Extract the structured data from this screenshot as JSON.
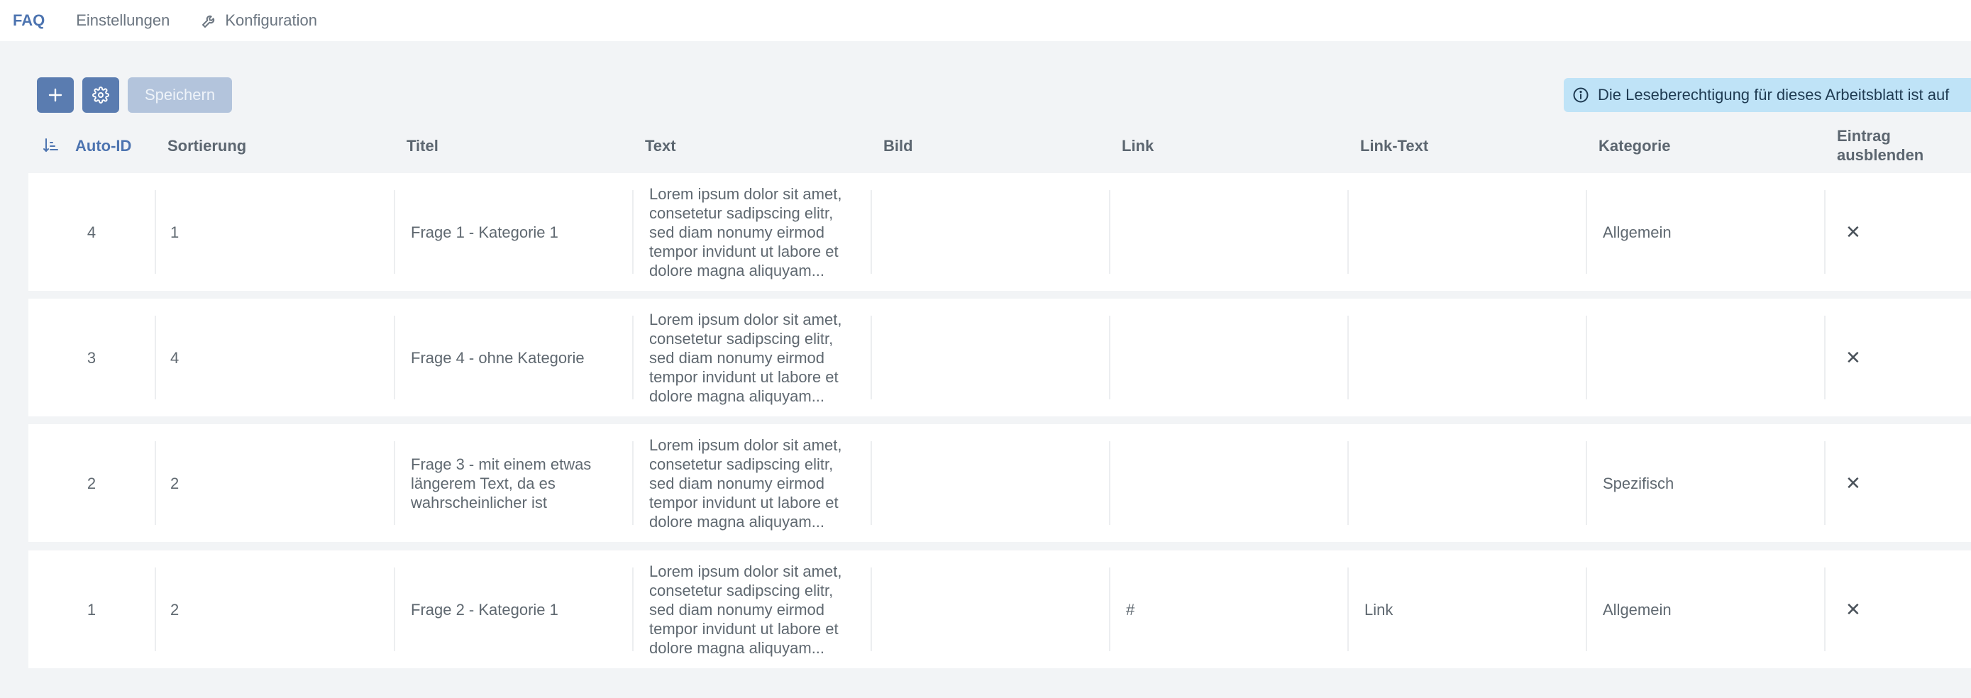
{
  "nav": {
    "tabs": [
      {
        "label": "FAQ"
      },
      {
        "label": "Einstellungen"
      },
      {
        "label": "Konfiguration"
      }
    ]
  },
  "toolbar": {
    "save_label": "Speichern"
  },
  "info_banner": {
    "text": "Die Leseberechtigung für dieses Arbeitsblatt ist auf"
  },
  "colors": {
    "accent": "#4d74b0",
    "button": "#5a7cb0",
    "button_disabled": "#b3c4dc",
    "info_bg": "#bfe3f7"
  },
  "table": {
    "columns": [
      {
        "label": "Auto-ID"
      },
      {
        "label": "Sortierung"
      },
      {
        "label": "Titel"
      },
      {
        "label": "Text"
      },
      {
        "label": "Bild"
      },
      {
        "label": "Link"
      },
      {
        "label": "Link-Text"
      },
      {
        "label": "Kategorie"
      },
      {
        "label": "Eintrag ausblenden"
      }
    ],
    "rows": [
      {
        "id": "4",
        "sort": "1",
        "title": "Frage 1 - Kategorie 1",
        "text": "Lorem ipsum dolor sit amet, consetetur sadipscing elitr, sed diam nonumy eirmod tempor invidunt ut labore et dolore magna aliquyam...",
        "image": "",
        "link": "",
        "link_text": "",
        "category": "Allgemein",
        "hidden": "✕"
      },
      {
        "id": "3",
        "sort": "4",
        "title": "Frage 4 - ohne Kategorie",
        "text": "Lorem ipsum dolor sit amet, consetetur sadipscing elitr, sed diam nonumy eirmod tempor invidunt ut labore et dolore magna aliquyam...",
        "image": "",
        "link": "",
        "link_text": "",
        "category": "",
        "hidden": "✕"
      },
      {
        "id": "2",
        "sort": "2",
        "title": "Frage 3 - mit einem etwas längerem Text, da es wahrscheinlicher ist",
        "text": "Lorem ipsum dolor sit amet, consetetur sadipscing elitr, sed diam nonumy eirmod tempor invidunt ut labore et dolore magna aliquyam...",
        "image": "",
        "link": "",
        "link_text": "",
        "category": "Spezifisch",
        "hidden": "✕"
      },
      {
        "id": "1",
        "sort": "2",
        "title": "Frage 2 - Kategorie 1",
        "text": "Lorem ipsum dolor sit amet, consetetur sadipscing elitr, sed diam nonumy eirmod tempor invidunt ut labore et dolore magna aliquyam...",
        "image": "",
        "link": "#",
        "link_text": "Link",
        "category": "Allgemein",
        "hidden": "✕"
      }
    ]
  }
}
